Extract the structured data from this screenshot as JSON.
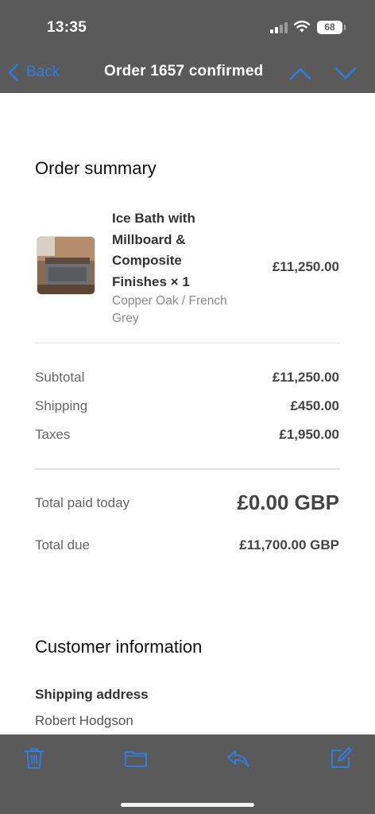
{
  "status_bar": {
    "time": "13:35",
    "battery": "68"
  },
  "nav": {
    "back_label": "Back",
    "title": "Order 1657 confirmed",
    "accent": "#2f7de1"
  },
  "order_summary": {
    "heading": "Order summary",
    "item": {
      "name": "Ice Bath with Millboard & Composite Finishes × 1",
      "variant": "Copper Oak / French Grey",
      "price": "£11,250.00"
    },
    "subtotal_label": "Subtotal",
    "subtotal_value": "£11,250.00",
    "shipping_label": "Shipping",
    "shipping_value": "£450.00",
    "taxes_label": "Taxes",
    "taxes_value": "£1,950.00",
    "total_paid_label": "Total paid today",
    "total_paid_value": "£0.00 GBP",
    "total_due_label": "Total due",
    "total_due_value": "£11,700.00 GBP"
  },
  "customer": {
    "heading": "Customer information",
    "shipping_address_label": "Shipping address",
    "shipping_address_name": "Robert Hodgson"
  },
  "toolbar": {
    "icons": [
      "trash-icon",
      "folder-icon",
      "reply-icon",
      "compose-icon"
    ]
  }
}
